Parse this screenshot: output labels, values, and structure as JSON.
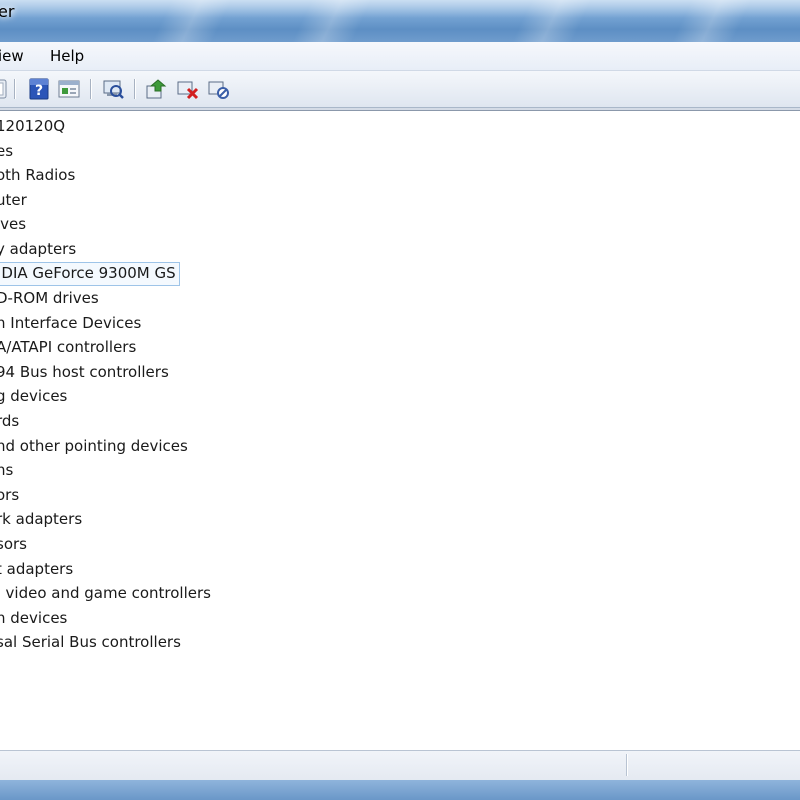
{
  "window": {
    "title_fragment": "er"
  },
  "menu": [
    {
      "label": "iew"
    },
    {
      "label": "Help"
    }
  ],
  "toolbar": {
    "icons": [
      "back-icon",
      "properties-icon",
      "help-icon",
      "show-hidden-icon",
      "scan-hardware-icon",
      "update-driver-icon",
      "uninstall-icon",
      "disable-icon"
    ]
  },
  "tree": {
    "items": [
      {
        "label": "120120Q"
      },
      {
        "label": "es"
      },
      {
        "label": "oth Radios"
      },
      {
        "label": "uter"
      },
      {
        "label": "ives"
      },
      {
        "label": "y adapters"
      },
      {
        "label": "IDIA GeForce 9300M GS"
      },
      {
        "label": "D-ROM drives"
      },
      {
        "label": "n Interface Devices"
      },
      {
        "label": "A/ATAPI controllers"
      },
      {
        "label": "94 Bus host controllers"
      },
      {
        "label": "g devices"
      },
      {
        "label": "rds"
      },
      {
        "label": "nd other pointing devices"
      },
      {
        "label": "ns"
      },
      {
        "label": "ors"
      },
      {
        "label": "rk adapters"
      },
      {
        "label": "sors"
      },
      {
        "label": "t adapters"
      },
      {
        "label": ", video and game controllers"
      },
      {
        "label": "n devices"
      },
      {
        "label": "sal Serial Bus controllers"
      }
    ]
  }
}
